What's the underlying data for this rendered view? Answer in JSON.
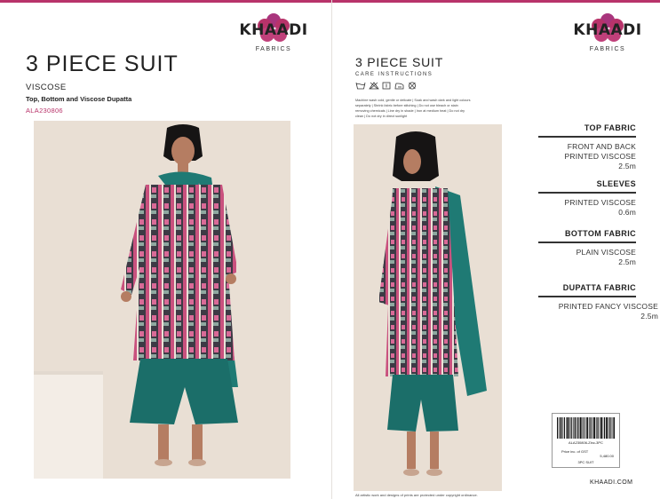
{
  "brand": {
    "name": "KHAADI",
    "sub": "FABRICS",
    "color": "#b8336a",
    "website": "KHAADI.COM"
  },
  "left_page": {
    "title": "3 PIECE SUIT",
    "fabric": "VISCOSE",
    "pieces": "Top, Bottom and Viscose  Dupatta",
    "article_code": "ALA230806"
  },
  "right_page": {
    "title": "3 PIECE SUIT",
    "care_label": "CARE INSTRUCTIONS",
    "care_icons": [
      "wash-30-icon",
      "no-bleach-icon",
      "hang-dry-icon",
      "iron-medium-icon",
      "no-dry-clean-icon"
    ],
    "care_text": "Machine wash cold, gentle or delicate | Soak and wash dark and light colours separately | Shrink fabric before stitching | Do not use bleach or stain removing chemicals | Line dry in shade | Iron at medium heat | Do not dry clean | Do not dry in direct sunlight",
    "specs": [
      {
        "head": "TOP FABRIC",
        "lines": [
          "FRONT AND BACK",
          "PRINTED VISCOSE"
        ],
        "qty": "2.5m"
      },
      {
        "head": "SLEEVES",
        "lines": [
          "PRINTED VISCOSE"
        ],
        "qty": "0.6m"
      },
      {
        "head": "BOTTOM FABRIC",
        "lines": [
          "PLAIN VISCOSE"
        ],
        "qty": "2.5m"
      },
      {
        "head": "DUPATTA FABRIC",
        "lines": [
          "PRINTED FANCY VISCOSE"
        ],
        "qty": "2.5m"
      }
    ],
    "tag": {
      "sku": "ALA230806-Zinc-3PC",
      "price_label": "Price inc. of GST",
      "price": "5,480.00",
      "type": "3PC SUIT"
    },
    "disclaimer": "All artistic work and designs of prints are protected under copyright ordinance."
  }
}
